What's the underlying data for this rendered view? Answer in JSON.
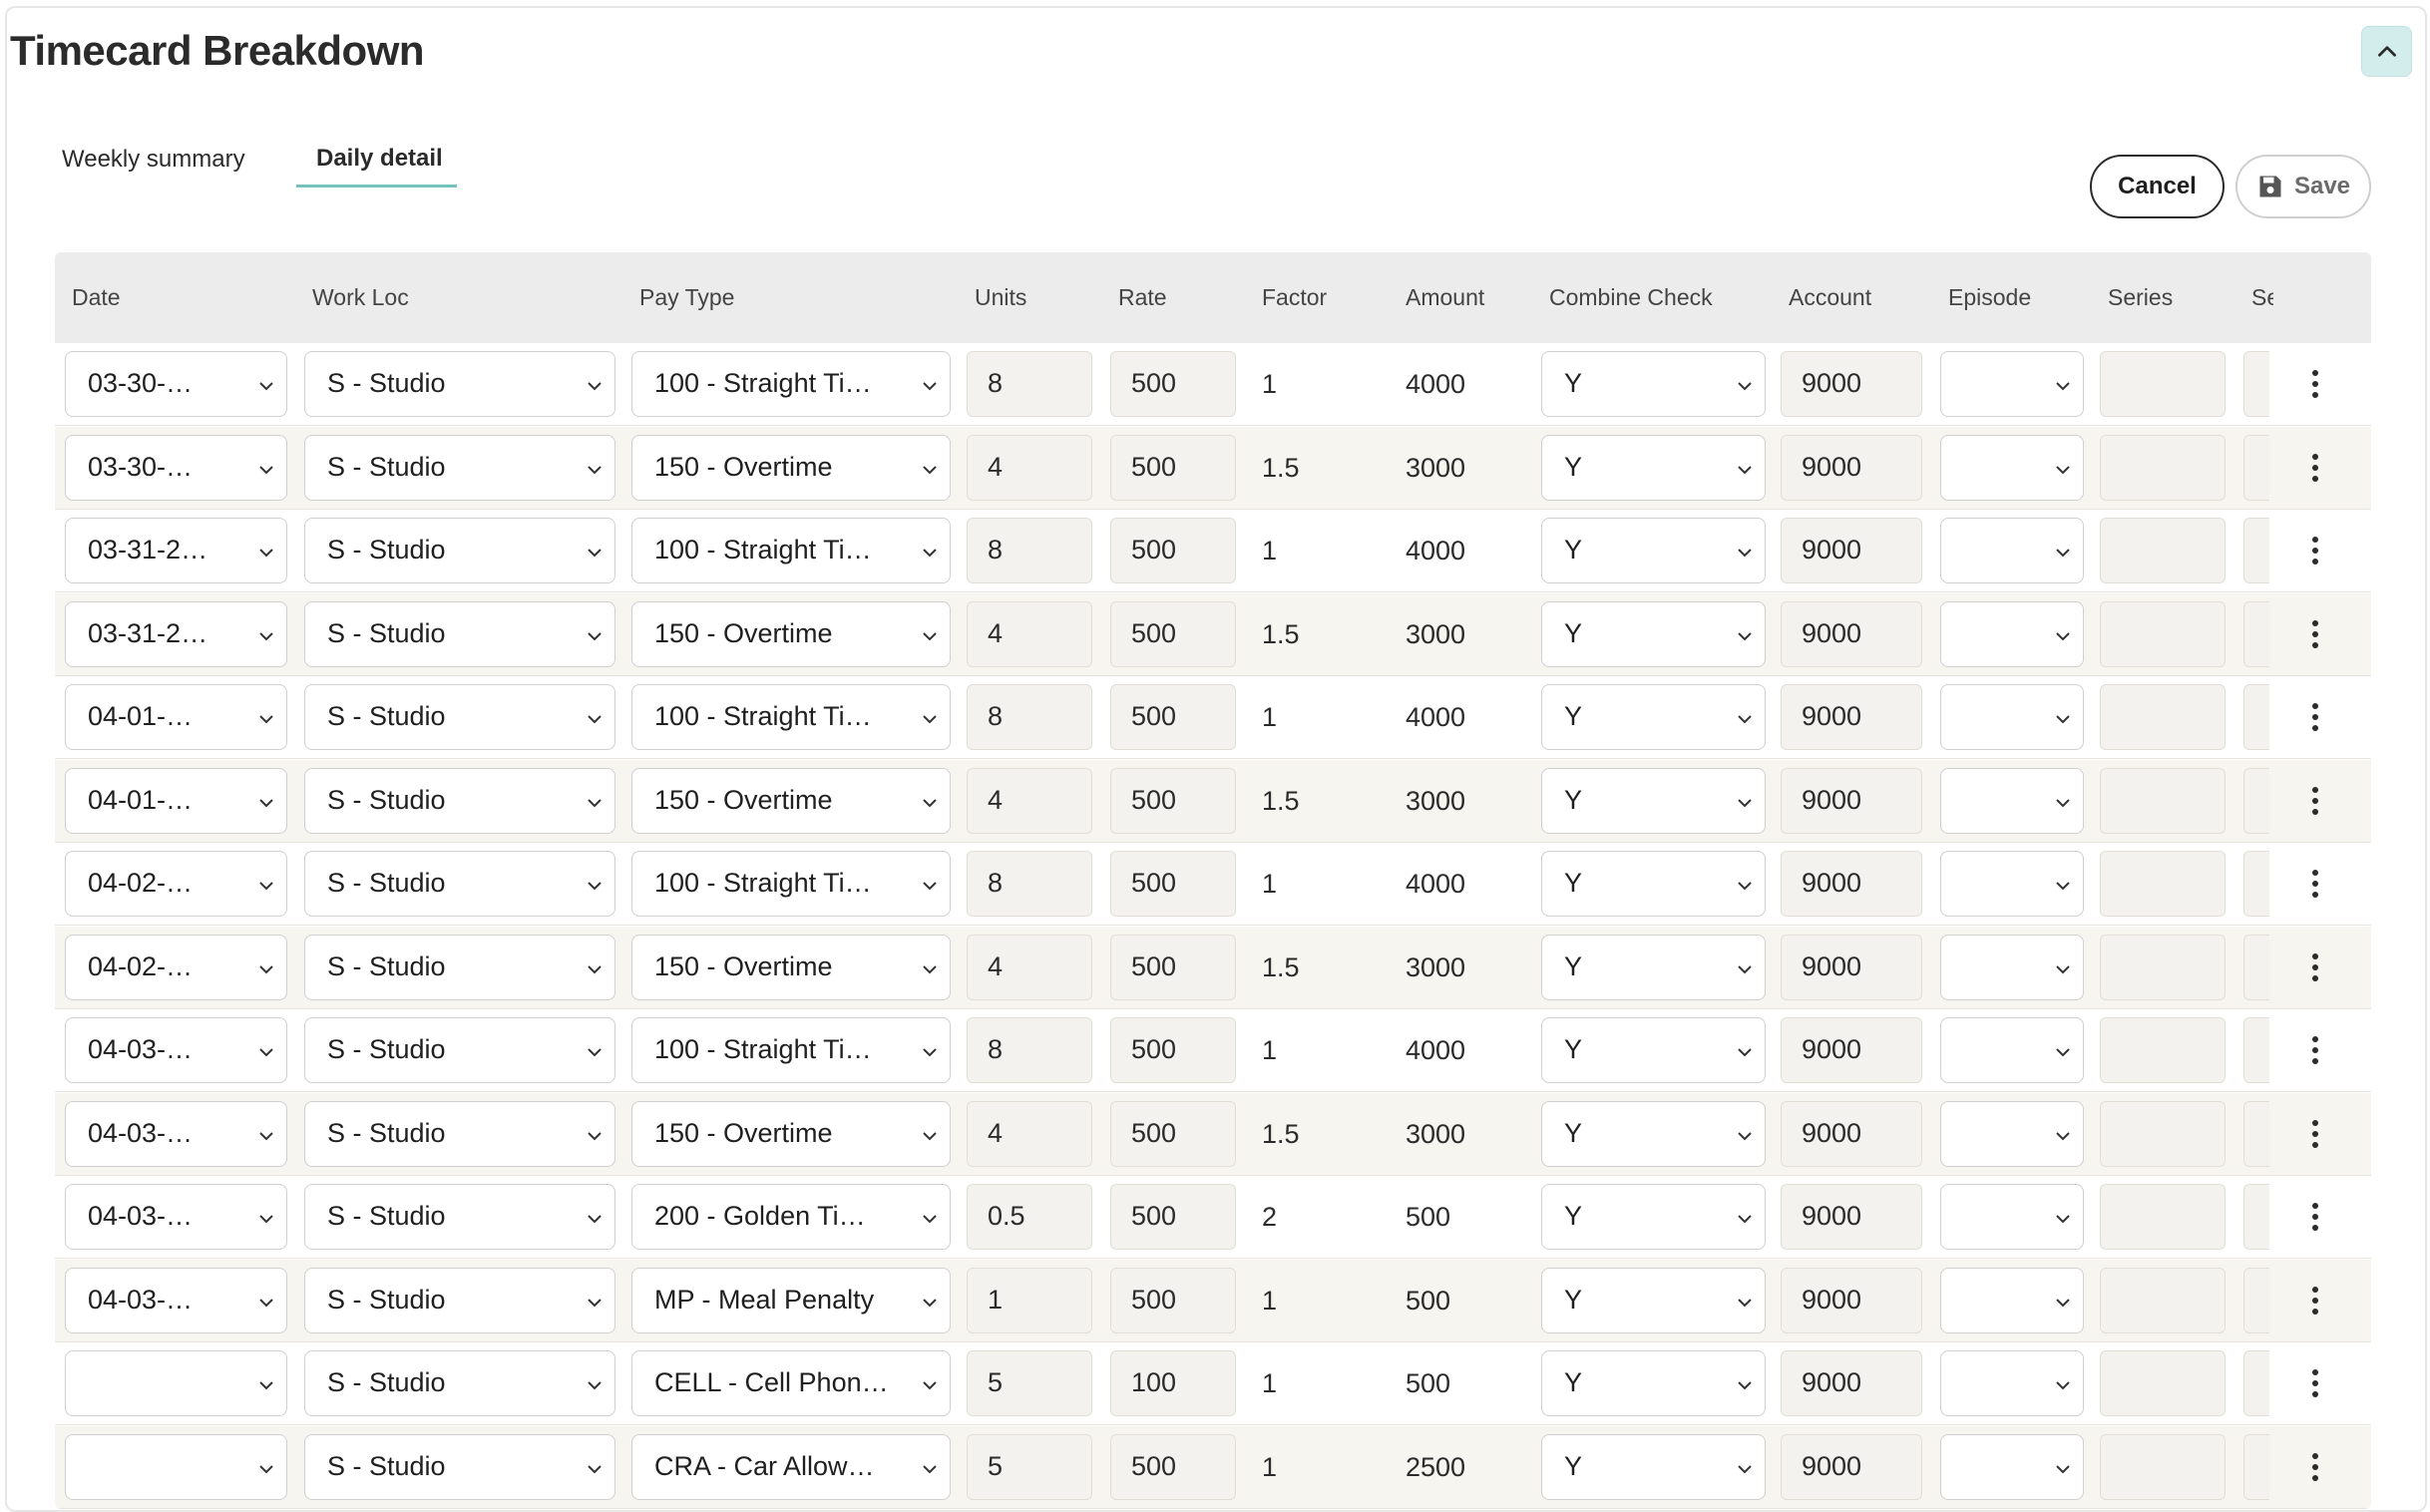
{
  "page": {
    "title": "Timecard Breakdown",
    "collapse_icon": "chevron-up-icon"
  },
  "tabs": [
    {
      "label": "Weekly summary",
      "active": false
    },
    {
      "label": "Daily detail",
      "active": true
    }
  ],
  "actions": {
    "cancel_label": "Cancel",
    "save_label": "Save",
    "save_icon": "floppy-disk-icon"
  },
  "colors": {
    "accent": "#73c2bd",
    "collapse_bg": "#d3edec",
    "row_alt": "#f7f5f0",
    "header_bg": "#ececec"
  },
  "table": {
    "columns": [
      "Date",
      "Work Loc",
      "Pay Type",
      "Units",
      "Rate",
      "Factor",
      "Amount",
      "Combine Check",
      "Account",
      "Episode",
      "Series",
      "Se"
    ],
    "rows": [
      {
        "date": "03-30-…",
        "work_loc": "S - Studio",
        "pay_type": "100 - Straight Ti…",
        "units": "8",
        "rate": "500",
        "factor": "1",
        "amount": "4000",
        "combine_check": "Y",
        "account": "9000",
        "episode": "",
        "series": ""
      },
      {
        "date": "03-30-…",
        "work_loc": "S - Studio",
        "pay_type": "150 - Overtime",
        "units": "4",
        "rate": "500",
        "factor": "1.5",
        "amount": "3000",
        "combine_check": "Y",
        "account": "9000",
        "episode": "",
        "series": ""
      },
      {
        "date": "03-31-2…",
        "work_loc": "S - Studio",
        "pay_type": "100 - Straight Ti…",
        "units": "8",
        "rate": "500",
        "factor": "1",
        "amount": "4000",
        "combine_check": "Y",
        "account": "9000",
        "episode": "",
        "series": ""
      },
      {
        "date": "03-31-2…",
        "work_loc": "S - Studio",
        "pay_type": "150 - Overtime",
        "units": "4",
        "rate": "500",
        "factor": "1.5",
        "amount": "3000",
        "combine_check": "Y",
        "account": "9000",
        "episode": "",
        "series": ""
      },
      {
        "date": "04-01-…",
        "work_loc": "S - Studio",
        "pay_type": "100 - Straight Ti…",
        "units": "8",
        "rate": "500",
        "factor": "1",
        "amount": "4000",
        "combine_check": "Y",
        "account": "9000",
        "episode": "",
        "series": ""
      },
      {
        "date": "04-01-…",
        "work_loc": "S - Studio",
        "pay_type": "150 - Overtime",
        "units": "4",
        "rate": "500",
        "factor": "1.5",
        "amount": "3000",
        "combine_check": "Y",
        "account": "9000",
        "episode": "",
        "series": ""
      },
      {
        "date": "04-02-…",
        "work_loc": "S - Studio",
        "pay_type": "100 - Straight Ti…",
        "units": "8",
        "rate": "500",
        "factor": "1",
        "amount": "4000",
        "combine_check": "Y",
        "account": "9000",
        "episode": "",
        "series": ""
      },
      {
        "date": "04-02-…",
        "work_loc": "S - Studio",
        "pay_type": "150 - Overtime",
        "units": "4",
        "rate": "500",
        "factor": "1.5",
        "amount": "3000",
        "combine_check": "Y",
        "account": "9000",
        "episode": "",
        "series": ""
      },
      {
        "date": "04-03-…",
        "work_loc": "S - Studio",
        "pay_type": "100 - Straight Ti…",
        "units": "8",
        "rate": "500",
        "factor": "1",
        "amount": "4000",
        "combine_check": "Y",
        "account": "9000",
        "episode": "",
        "series": ""
      },
      {
        "date": "04-03-…",
        "work_loc": "S - Studio",
        "pay_type": "150 - Overtime",
        "units": "4",
        "rate": "500",
        "factor": "1.5",
        "amount": "3000",
        "combine_check": "Y",
        "account": "9000",
        "episode": "",
        "series": ""
      },
      {
        "date": "04-03-…",
        "work_loc": "S - Studio",
        "pay_type": "200 - Golden Ti…",
        "units": "0.5",
        "rate": "500",
        "factor": "2",
        "amount": "500",
        "combine_check": "Y",
        "account": "9000",
        "episode": "",
        "series": ""
      },
      {
        "date": "04-03-…",
        "work_loc": "S - Studio",
        "pay_type": "MP - Meal Penalty",
        "units": "1",
        "rate": "500",
        "factor": "1",
        "amount": "500",
        "combine_check": "Y",
        "account": "9000",
        "episode": "",
        "series": ""
      },
      {
        "date": "",
        "work_loc": "S - Studio",
        "pay_type": "CELL - Cell Phon…",
        "units": "5",
        "rate": "100",
        "factor": "1",
        "amount": "500",
        "combine_check": "Y",
        "account": "9000",
        "episode": "",
        "series": ""
      },
      {
        "date": "",
        "work_loc": "S - Studio",
        "pay_type": "CRA - Car Allow…",
        "units": "5",
        "rate": "500",
        "factor": "1",
        "amount": "2500",
        "combine_check": "Y",
        "account": "9000",
        "episode": "",
        "series": ""
      }
    ],
    "row_menu_icon": "kebab-menu-icon"
  }
}
